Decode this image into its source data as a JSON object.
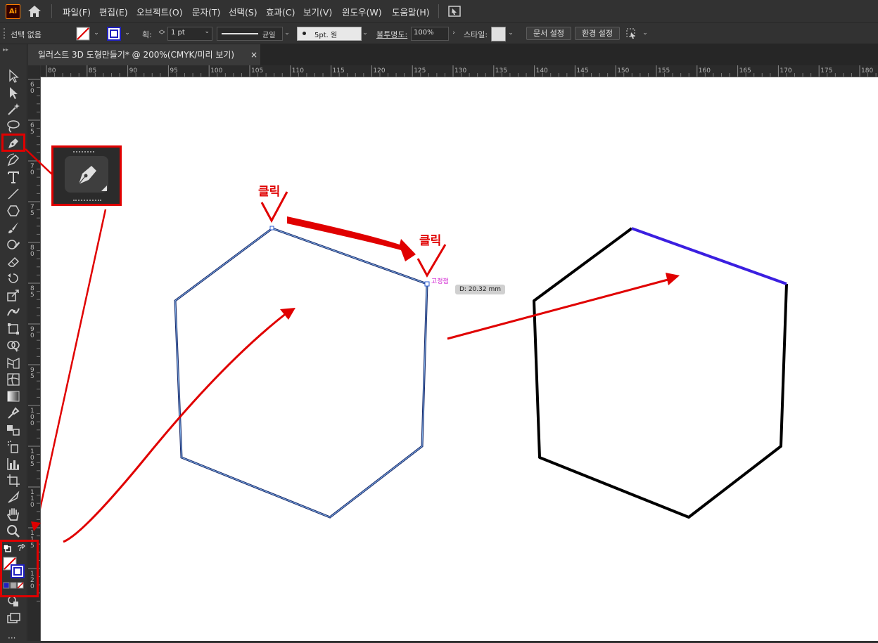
{
  "app": {
    "logo": "Ai"
  },
  "menu": [
    "파일(F)",
    "편집(E)",
    "오브젝트(O)",
    "문자(T)",
    "선택(S)",
    "효과(C)",
    "보기(V)",
    "윈도우(W)",
    "도움말(H)"
  ],
  "control_bar": {
    "selection_status": "선택 없음",
    "stroke_label": "획:",
    "stroke_weight": "1 pt",
    "stroke_style": "균일",
    "brush": "5pt. 원",
    "opacity_label": "불투명도:",
    "opacity_value": "100%",
    "style_label": "스타일:",
    "doc_setup_button": "문서 설정",
    "preferences_button": "환경 설정"
  },
  "document_tab": {
    "title": "일러스트 3D 도형만들기* @ 200%(CMYK/미리 보기)",
    "close": "×"
  },
  "horizontal_ruler": [
    "80",
    "85",
    "90",
    "95",
    "100",
    "105",
    "110",
    "115",
    "120",
    "125",
    "130",
    "135",
    "140",
    "145",
    "150",
    "155",
    "160",
    "165",
    "170",
    "175",
    "180"
  ],
  "vertical_ruler": [
    "6\n0",
    "6\n5",
    "7\n0",
    "7\n5",
    "8\n0",
    "8\n5",
    "9\n0",
    "9\n5",
    "1\n0\n0",
    "1\n0\n5",
    "1\n1\n0",
    "1\n1\n5",
    "1\n2\n0"
  ],
  "canvas": {
    "click_label_1": "클릭",
    "click_label_2": "클릭",
    "anchor_label": "고정점",
    "distance_tooltip": "D: 20.32 mm"
  },
  "colors": {
    "annotation_red": "#e00000",
    "selected_segment_blue": "#3b1fe0",
    "anchor_magenta": "#d020d0",
    "path_navy": "#1a2a6a"
  }
}
